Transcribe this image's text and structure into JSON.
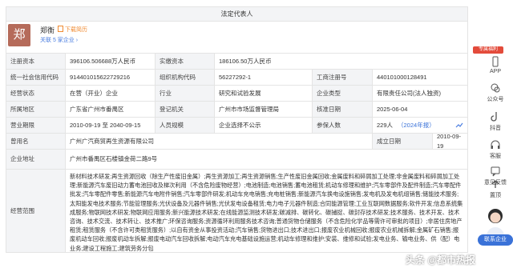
{
  "header": {
    "title": "法定代表人"
  },
  "rep": {
    "avatar_char": "郑",
    "name": "郑衡",
    "resume_link": "下载简历",
    "related": "关联 5 家企业 ›"
  },
  "rows": [
    {
      "l1": "注册资本",
      "v1": "396106.506688万人民币",
      "l2": "实缴资本",
      "v2": "186106.50万人民币",
      "l3": "",
      "v3": ""
    },
    {
      "l1": "统一社会信用代码",
      "v1": "914401015622729216",
      "l2": "组织机构代码",
      "v2": "56227292-1",
      "l3": "工商注册号",
      "v3": "440101000128491"
    },
    {
      "l1": "经营状态",
      "v1": "在营（开业）企业",
      "l2": "行业",
      "v2": "研究和试验发展",
      "l3": "企业类型",
      "v3": "有限责任公司(法人独资)"
    },
    {
      "l1": "所属地区",
      "v1": "广东省广州市番禺区",
      "l2": "登记机关",
      "v2": "广州市市场监督管理局",
      "l3": "核准日期",
      "v3": "2025-06-04"
    },
    {
      "l1": "营业期限",
      "v1": "2010-09-19 至 2040-09-15",
      "l2": "人员规模",
      "v2": "企业选择不公示",
      "l3": "参保人数",
      "v3": "229人"
    },
    {
      "l1": "曾用名",
      "v1": "广州广汽商贸再生资源有限公司",
      "l2": "",
      "v2": "",
      "l3": "成立日期",
      "v3": "2010-09-19"
    }
  ],
  "insured_year": "（2024年报）",
  "address": {
    "label": "企业地址",
    "value": "广州市番禺区石楼镇金荷二路9号"
  },
  "scope": {
    "label": "经营范围",
    "value": "新材料技术研发;再生资源回收（除生产性废旧金属）;再生资源加工;再生资源销售;生产性废旧金属回收;金属废料和碎屑加工处理;非金属废料和碎屑加工处理;新能源汽车废旧动力蓄电池回收及梯次利用（不含危险废物经营）;电池制造;电池销售;蓄电池租赁;机动车修理和维护;汽车零部件及配件制造;汽车零配件批发;汽车零配件零售;新能源汽车电附件销售;汽车零部件研发;机动车充电销售;充电桩销售;新能源汽车换电设施销售;发电机及发电机组销售;储能技术服务;太阳能发电技术服务;节能管理服务;光伏设备及元器件销售;光伏发电设备租赁;电力电子元器件制造;合同能源管理;工业互联网数据服务;软件开发;信息系统集成服务;物联网技术研发;物联网应用服务;新兴能源技术研发;在线能源监测技术研发;碳减排、碳转化、碳捕捉、碳封存技术研发;技术服务、技术开发、技术咨询、技术交流、技术转让、技术推广;环保咨询服务;资源循环利用服务技术咨询;普通货物仓储服务（不含危险化学品等需许可审批的项目）;非居住房地产租赁;租赁服务（不含许可类租赁服务）;以自有资金从事投资活动;汽车销售;货物进出口;技术进出口;报废农业机械回收;报废农业机械拆解;金属矿石销售;报废机动车回收;报废机动车拆解;报废电动汽车回收拆解;电动汽车充电基础设施运营;机动车修理和维护;安装、维修和试验;发电业务、输电业务、供（配）电业务;建设工程施工;建筑劳务分包"
  },
  "sidebar": {
    "tag": "专属福利",
    "items": [
      "APP",
      "公众号",
      "抖音",
      "客服",
      "意见反馈",
      "置顶"
    ]
  },
  "helper": {
    "label": "联系企业"
  },
  "watermark": "头条 @都市热报"
}
